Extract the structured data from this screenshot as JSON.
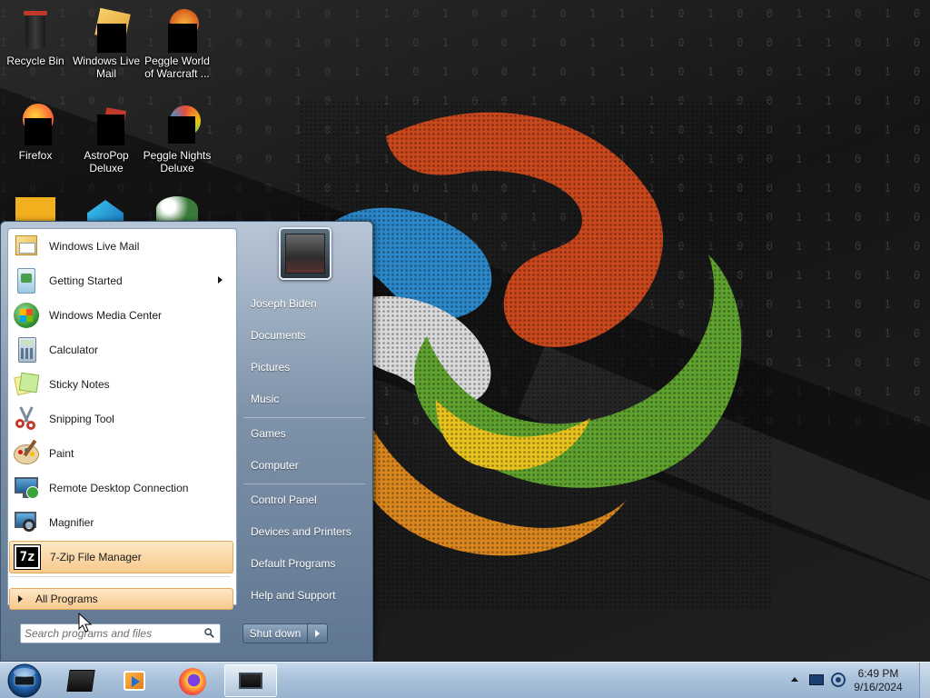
{
  "desktop": {
    "binary_text": "1 0 1 0 0 1 1 1 0 0 1 0 1 1 0 1 0 0 1 0 1 1 1 0 1 0 0 1 1 0 1 0 1 0 1 1 0 0 1 0 1 0 1 1 0 1 0 0 1 0 1 0",
    "icons": [
      {
        "label": "Recycle Bin",
        "icon": "recycle-bin-icon"
      },
      {
        "label": "Windows Live Mail",
        "icon": "windows-live-mail-icon"
      },
      {
        "label": "Peggle World of Warcraft ...",
        "icon": "peggle-wow-icon"
      },
      {
        "label": "Firefox",
        "icon": "firefox-icon"
      },
      {
        "label": "AstroPop Deluxe",
        "icon": "astropop-icon"
      },
      {
        "label": "Peggle Nights Deluxe",
        "icon": "peggle-nights-icon"
      }
    ]
  },
  "start_menu": {
    "programs": [
      {
        "label": "Windows Live Mail",
        "icon": "mail-icon"
      },
      {
        "label": "Getting Started",
        "icon": "getting-started-icon",
        "has_submenu": true
      },
      {
        "label": "Windows Media Center",
        "icon": "media-center-icon"
      },
      {
        "label": "Calculator",
        "icon": "calculator-icon"
      },
      {
        "label": "Sticky Notes",
        "icon": "sticky-notes-icon"
      },
      {
        "label": "Snipping Tool",
        "icon": "scissors-icon"
      },
      {
        "label": "Paint",
        "icon": "paint-icon"
      },
      {
        "label": "Remote Desktop Connection",
        "icon": "remote-desktop-icon"
      },
      {
        "label": "Magnifier",
        "icon": "magnifier-icon"
      },
      {
        "label": "7-Zip File Manager",
        "icon": "7zip-icon",
        "highlighted": true
      }
    ],
    "all_programs": "All Programs",
    "search_placeholder": "Search programs and files",
    "right_links": {
      "user": "Joseph Biden",
      "documents": "Documents",
      "pictures": "Pictures",
      "music": "Music",
      "games": "Games",
      "computer": "Computer",
      "control_panel": "Control Panel",
      "devices": "Devices and Printers",
      "default_programs": "Default Programs",
      "help": "Help and Support"
    },
    "shutdown_label": "Shut down"
  },
  "taskbar": {
    "pinned": [
      "file-cabinet-icon",
      "media-player-icon",
      "firefox-icon",
      "monitor-app-icon"
    ],
    "clock_time": "6:49 PM",
    "clock_date": "9/16/2024"
  },
  "colors": {
    "highlight": "#f7c98c",
    "taskbar": "#a8c0d9",
    "start_menu_frame": "#7d91a8"
  }
}
